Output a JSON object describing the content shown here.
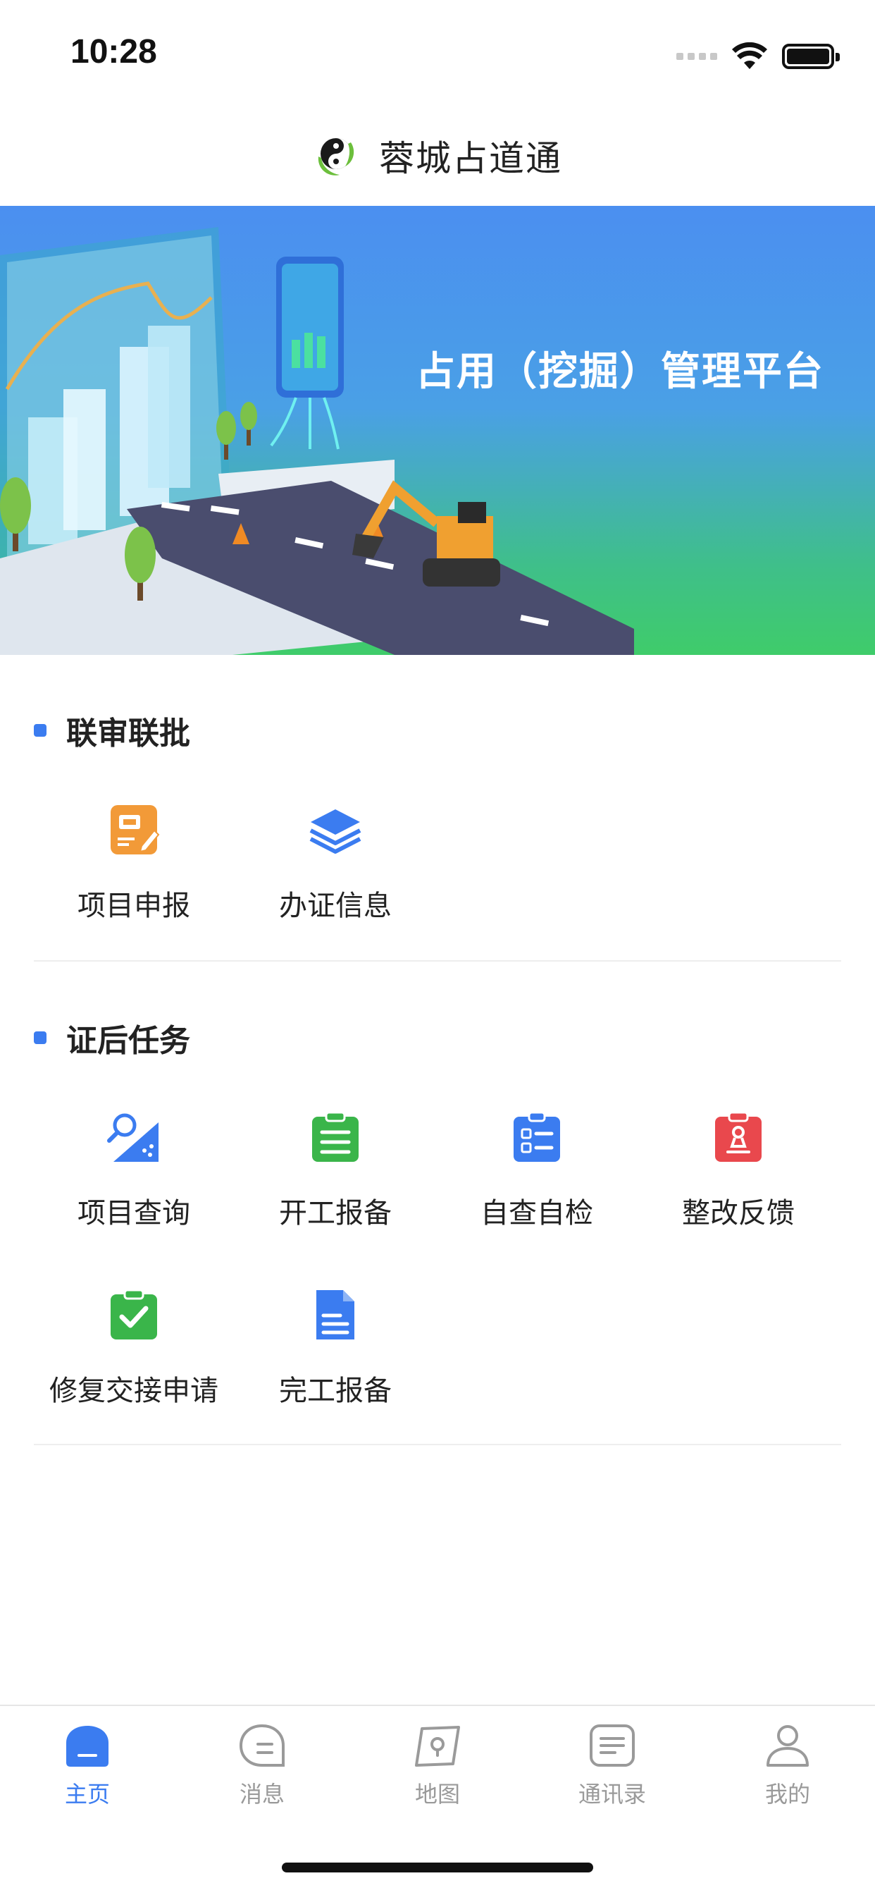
{
  "status_bar": {
    "time": "10:28"
  },
  "header": {
    "title": "蓉城占道通",
    "logo_icon": "app-logo"
  },
  "banner": {
    "title": "占用（挖掘）管理平台"
  },
  "section_joint": {
    "title": "联审联批",
    "items": [
      {
        "label": "项目申报",
        "icon": "project-report-icon",
        "color": "#f29a38"
      },
      {
        "label": "办证信息",
        "icon": "layers-icon",
        "color": "#3b7cf0"
      }
    ]
  },
  "section_post": {
    "title": "证后任务",
    "items": [
      {
        "label": "项目查询",
        "icon": "search-document-icon",
        "color": "#3b7cf0"
      },
      {
        "label": "开工报备",
        "icon": "clipboard-list-icon",
        "color": "#3ab54a"
      },
      {
        "label": "自查自检",
        "icon": "checklist-icon",
        "color": "#3b7cf0"
      },
      {
        "label": "整改反馈",
        "icon": "stamp-icon",
        "color": "#e9484d"
      },
      {
        "label": "修复交接申请",
        "icon": "clipboard-check-icon",
        "color": "#3ab54a"
      },
      {
        "label": "完工报备",
        "icon": "document-icon",
        "color": "#3b7cf0"
      }
    ]
  },
  "tab_bar": {
    "active_color": "#3b7cf0",
    "inactive_color": "#9a9a9a",
    "tabs": [
      {
        "label": "主页",
        "icon": "home-icon",
        "active": true
      },
      {
        "label": "消息",
        "icon": "message-icon",
        "active": false
      },
      {
        "label": "地图",
        "icon": "map-icon",
        "active": false
      },
      {
        "label": "通讯录",
        "icon": "contacts-icon",
        "active": false
      },
      {
        "label": "我的",
        "icon": "profile-icon",
        "active": false
      }
    ]
  }
}
